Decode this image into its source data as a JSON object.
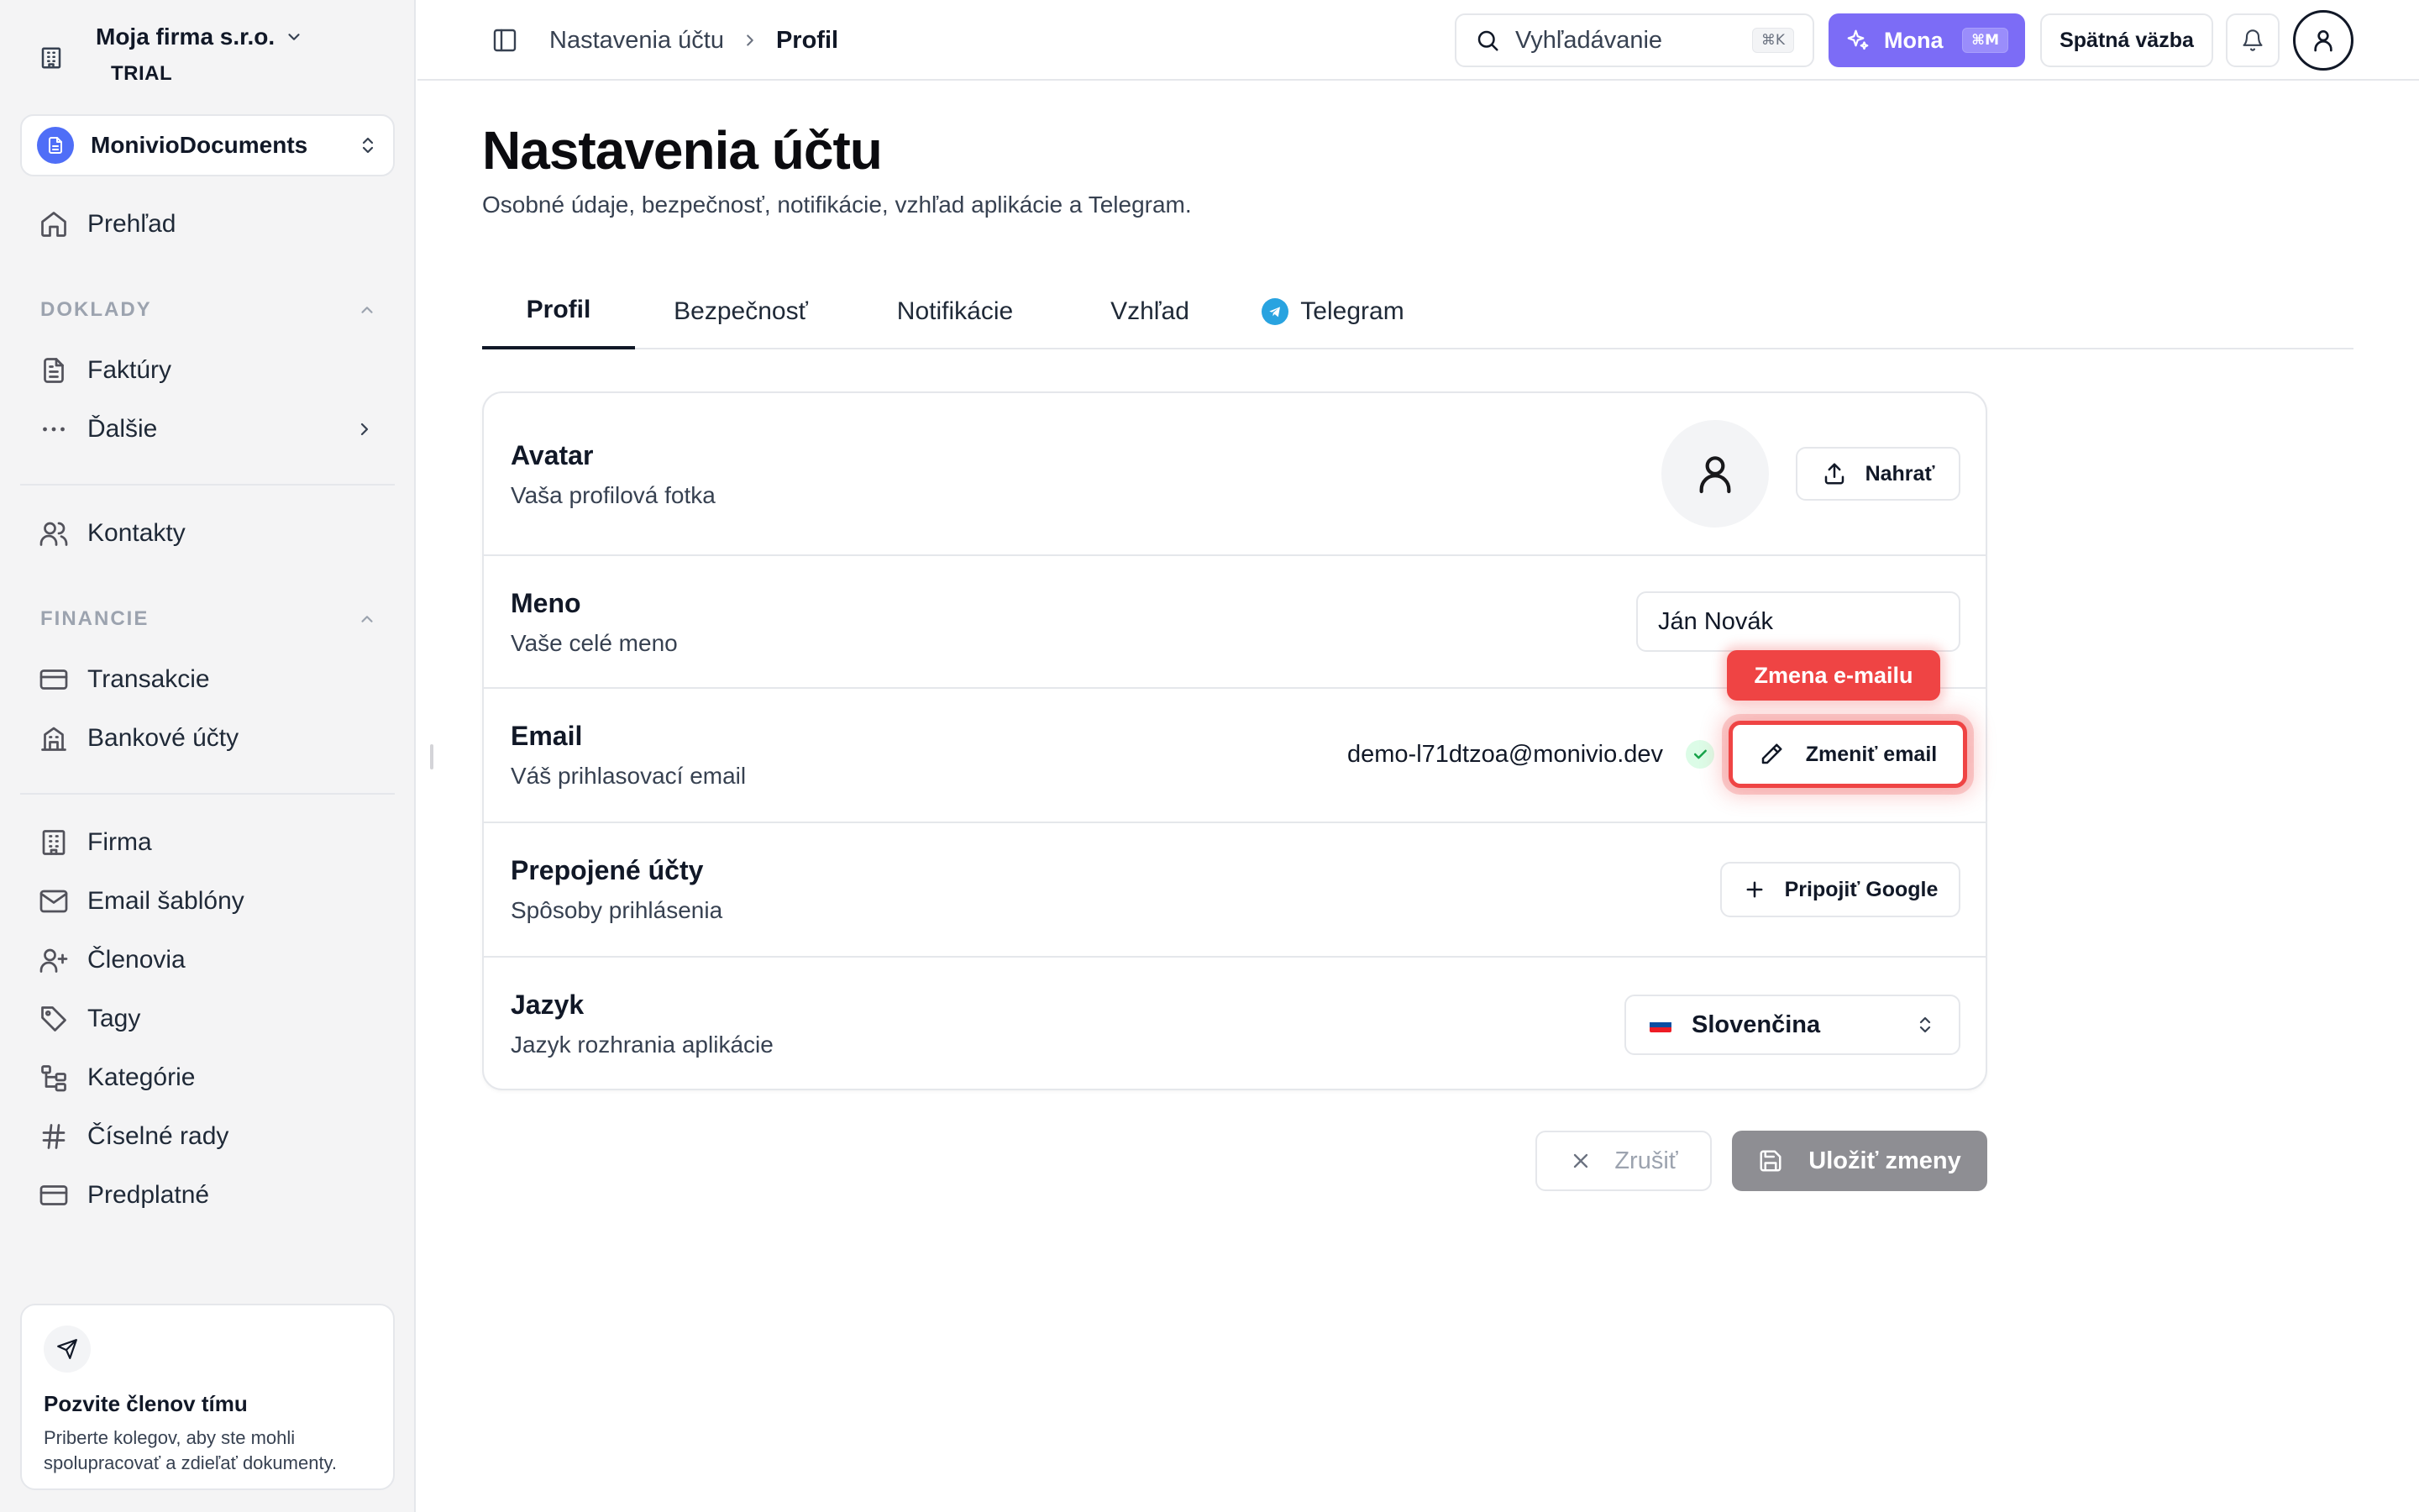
{
  "sidebar": {
    "company_name": "Moja firma s.r.o.",
    "company_plan": "TRIAL",
    "workspace": "MonivioDocuments",
    "overview": "Prehľad",
    "section_doklady": "DOKLADY",
    "invoices": "Faktúry",
    "more": "Ďalšie",
    "contacts": "Kontakty",
    "section_financie": "FINANCIE",
    "transactions": "Transakcie",
    "bank_accounts": "Bankové účty",
    "company": "Firma",
    "email_templates": "Email šablóny",
    "members": "Členovia",
    "tags": "Tagy",
    "categories": "Kategórie",
    "number_series": "Číselné rady",
    "subscription": "Predplatné",
    "invite": {
      "title": "Pozvite členov tímu",
      "description": "Priberte kolegov, aby ste mohli spolupracovať a zdieľať dokumenty."
    }
  },
  "topbar": {
    "breadcrumb_parent": "Nastavenia účtu",
    "breadcrumb_current": "Profil",
    "search_placeholder": "Vyhľadávanie",
    "search_shortcut": "⌘K",
    "mona_label": "Mona",
    "mona_shortcut": "⌘M",
    "feedback_label": "Spätná väzba"
  },
  "page": {
    "title": "Nastavenia účtu",
    "subtitle": "Osobné údaje, bezpečnosť, notifikácie, vzhľad aplikácie a Telegram."
  },
  "tabs": [
    "Profil",
    "Bezpečnosť",
    "Notifikácie",
    "Vzhľad",
    "Telegram"
  ],
  "profile": {
    "avatar": {
      "label": "Avatar",
      "description": "Vaša profilová fotka",
      "button": "Nahrať"
    },
    "name": {
      "label": "Meno",
      "description": "Vaše celé meno",
      "value": "Ján Novák"
    },
    "email": {
      "label": "Email",
      "description": "Váš prihlasovací email",
      "value": "demo-l71dtzoa@monivio.dev",
      "button": "Zmeniť email",
      "tooltip": "Zmena e-mailu"
    },
    "connected": {
      "label": "Prepojené účty",
      "description": "Spôsoby prihlásenia",
      "button": "Pripojiť Google"
    },
    "language": {
      "label": "Jazyk",
      "description": "Jazyk rozhrania aplikácie",
      "value": "Slovenčina"
    }
  },
  "actions": {
    "cancel": "Zrušiť",
    "save": "Uložiť zmeny"
  },
  "colors": {
    "accent": "#7c6cf6",
    "highlight": "#ef4444",
    "save_disabled": "#8e8e93",
    "telegram": "#29a3e0"
  }
}
